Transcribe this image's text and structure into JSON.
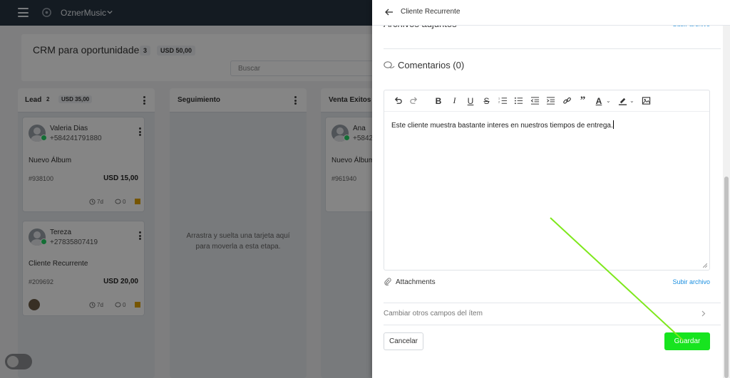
{
  "topbar": {
    "org_name": "OznerMusic"
  },
  "crm": {
    "title": "CRM para oportunidades",
    "count": "3",
    "total": "USD 50,00",
    "search_placeholder": "Buscar"
  },
  "columns": [
    {
      "title": "Lead",
      "count": "2",
      "amount": "USD 35,00",
      "cards": [
        {
          "name": "Valeria Dias",
          "phone": "+584241791880",
          "desc": "Nuevo Álbum",
          "id": "#938100",
          "amount": "USD 15,00",
          "age": "7d",
          "comments": "0"
        },
        {
          "name": "Tereza",
          "phone": "+27835807419",
          "desc": "Cliente Recurrente",
          "id": "#209692",
          "amount": "USD 20,00",
          "age": "7d",
          "comments": "0"
        }
      ]
    },
    {
      "title": "Seguimiento",
      "empty_line1": "Arrastra y suelta una tarjeta aquí",
      "empty_line2": "para moverla a esta etapa."
    },
    {
      "title": "Venta Exitos",
      "cards": [
        {
          "name": "Ana",
          "phone": "+5842",
          "desc": "Nuevo Álbum",
          "id": "#961940"
        }
      ]
    }
  ],
  "drawer": {
    "title": "Cliente Recurrente",
    "attachments_top_title": "Archivos adjuntos",
    "attachments_top_link": "Subir archivo",
    "comments_title": "Comentarios (0)",
    "editor_text": "Este cliente muestra bastante interes en nuestros tiempos de entrega.",
    "attachments_label": "Attachments",
    "attachments_link": "Subir archivo",
    "other_fields_label": "Cambiar otros campos del ítem",
    "cancel_label": "Cancelar",
    "save_label": "Guardar"
  },
  "colors": {
    "topbar": "#283442",
    "save_button": "#17e41f",
    "link": "#1a8fe0",
    "flag": "#e2a400",
    "whatsapp": "#25d366",
    "pointer_line": "#7ee81c"
  },
  "toolbar_icons": [
    "undo-icon",
    "redo-icon",
    "bold-icon",
    "italic-icon",
    "underline-icon",
    "strikethrough-icon",
    "ordered-list-icon",
    "bullet-list-icon",
    "outdent-icon",
    "indent-icon",
    "link-icon",
    "quote-icon",
    "text-color-icon",
    "highlight-icon",
    "image-icon"
  ]
}
